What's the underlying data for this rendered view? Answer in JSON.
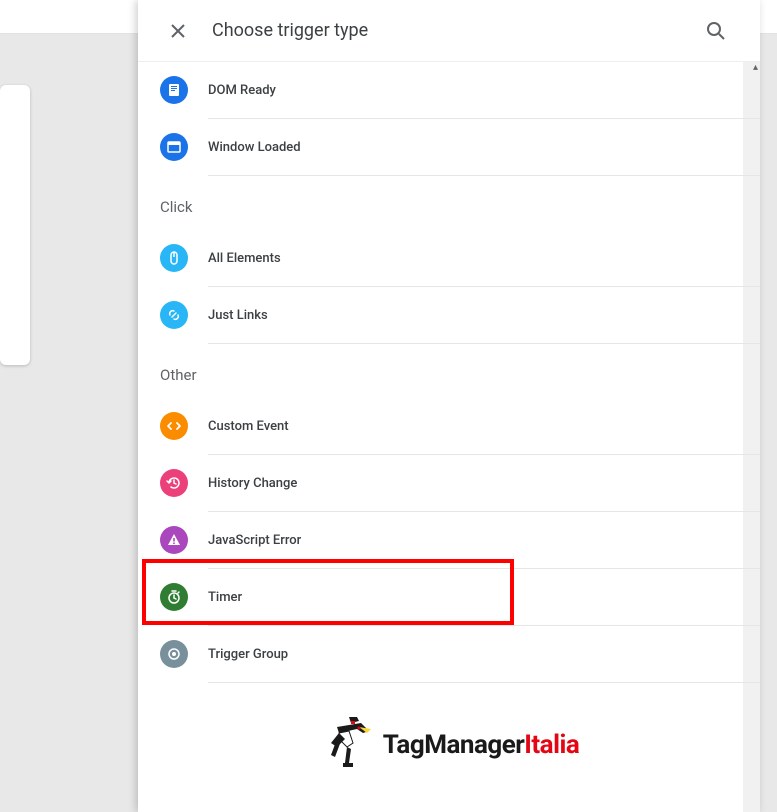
{
  "header": {
    "title": "Choose trigger type"
  },
  "categories": [
    {
      "label": "",
      "items": [
        {
          "icon": "dom-ready-icon",
          "color": "ic-blue",
          "label": "DOM Ready"
        },
        {
          "icon": "window-loaded-icon",
          "color": "ic-blue",
          "label": "Window Loaded"
        }
      ]
    },
    {
      "label": "Click",
      "items": [
        {
          "icon": "mouse-icon",
          "color": "ic-cyan",
          "label": "All Elements"
        },
        {
          "icon": "link-icon",
          "color": "ic-cyan",
          "label": "Just Links"
        }
      ]
    },
    {
      "label": "Other",
      "items": [
        {
          "icon": "code-icon",
          "color": "ic-orange",
          "label": "Custom Event"
        },
        {
          "icon": "history-icon",
          "color": "ic-pink",
          "label": "History Change"
        },
        {
          "icon": "error-icon",
          "color": "ic-purple",
          "label": "JavaScript Error"
        },
        {
          "icon": "timer-icon",
          "color": "ic-green",
          "label": "Timer",
          "highlighted": true
        },
        {
          "icon": "group-icon",
          "color": "ic-grey",
          "label": "Trigger Group"
        }
      ]
    }
  ],
  "logo": {
    "text1": "TagManager",
    "text2": "Italia"
  }
}
